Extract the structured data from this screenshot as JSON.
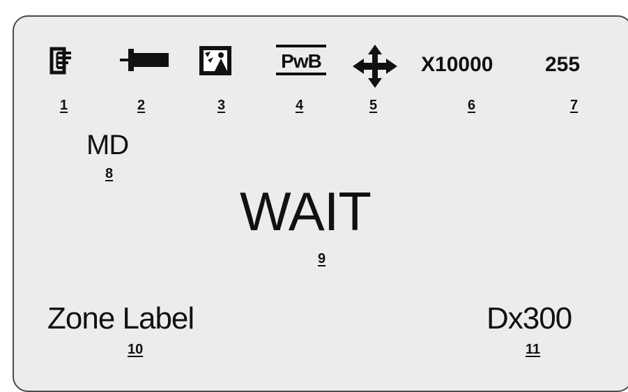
{
  "status_bar": {
    "icons": [
      {
        "name": "tool-icon",
        "label": "1"
      },
      {
        "name": "plug-icon",
        "label": "2"
      },
      {
        "name": "service-icon",
        "label": "3"
      },
      {
        "name": "pwb-icon",
        "text": "PwB",
        "label": "4"
      },
      {
        "name": "move-icon",
        "label": "5"
      }
    ],
    "multiplier": {
      "text": "X10000",
      "label": "6"
    },
    "value": {
      "text": "255",
      "label": "7"
    }
  },
  "mode": {
    "text": "MD",
    "label": "8"
  },
  "status": {
    "text": "WAIT",
    "label": "9"
  },
  "zone": {
    "text": "Zone Label",
    "label": "10"
  },
  "code": {
    "text": "Dx300",
    "label": "11"
  }
}
